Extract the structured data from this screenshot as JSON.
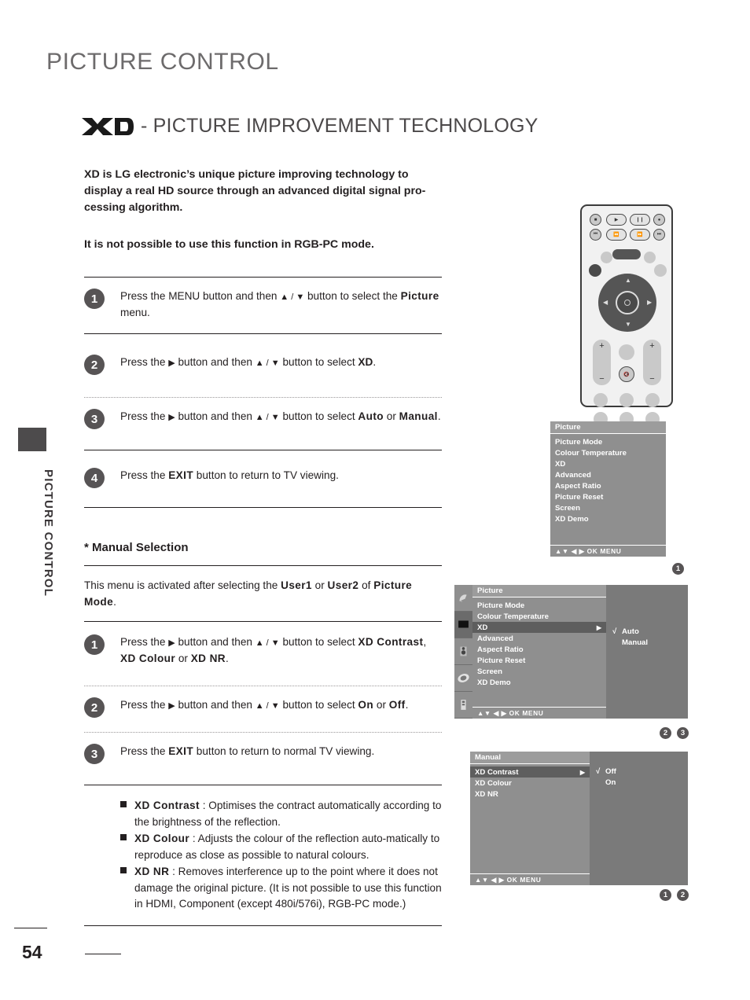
{
  "page": {
    "number": "54",
    "side_tab_label": "PICTURE CONTROL",
    "heading": "PICTURE CONTROL",
    "sub_heading": "- PICTURE IMPROVEMENT TECHNOLOGY",
    "logo_text": "XD"
  },
  "intro": {
    "paragraph1": "XD is LG electronic’s unique picture improving technology to display a real HD source through an advanced digital signal pro-cessing algorithm.",
    "paragraph2": "It is not possible to use this function in RGB-PC mode."
  },
  "steps": [
    {
      "number": "1",
      "parts": [
        {
          "t": "Press the MENU button and then ",
          "s": "n"
        },
        {
          "t": "▲ / ▼",
          "s": "arr"
        },
        {
          "t": " button to select the ",
          "s": "n"
        },
        {
          "t": "Picture",
          "s": "mono"
        },
        {
          "t": "  menu.",
          "s": "n"
        }
      ]
    },
    {
      "number": "2",
      "parts": [
        {
          "t": "Press the ",
          "s": "n"
        },
        {
          "t": "▶",
          "s": "arr"
        },
        {
          "t": " button and then ",
          "s": "n"
        },
        {
          "t": "▲ / ▼",
          "s": "arr"
        },
        {
          "t": " button to select ",
          "s": "n"
        },
        {
          "t": "XD",
          "s": "b"
        },
        {
          "t": ".",
          "s": "n"
        }
      ]
    },
    {
      "number": "3",
      "parts": [
        {
          "t": "Press the ",
          "s": "n"
        },
        {
          "t": "▶",
          "s": "arr"
        },
        {
          "t": " button and then ",
          "s": "n"
        },
        {
          "t": "▲ / ▼",
          "s": "arr"
        },
        {
          "t": " button to select ",
          "s": "n"
        },
        {
          "t": "Auto",
          "s": "mono"
        },
        {
          "t": " or ",
          "s": "n"
        },
        {
          "t": "Manual",
          "s": "mono"
        },
        {
          "t": ".",
          "s": "n"
        }
      ]
    },
    {
      "number": "4",
      "parts": [
        {
          "t": "Press the ",
          "s": "n"
        },
        {
          "t": "EXIT",
          "s": "mono"
        },
        {
          "t": " button to return to TV viewing.",
          "s": "n"
        }
      ]
    }
  ],
  "manual_section": {
    "title": "* Manual Selection",
    "note_parts": [
      {
        "t": "This menu is activated after selecting the ",
        "s": "n"
      },
      {
        "t": "User1",
        "s": "mono"
      },
      {
        "t": " or ",
        "s": "n"
      },
      {
        "t": "User2",
        "s": "mono"
      },
      {
        "t": " of ",
        "s": "n"
      },
      {
        "t": "Picture Mode",
        "s": "mono"
      },
      {
        "t": ".",
        "s": "n"
      }
    ],
    "steps": [
      {
        "number": "1",
        "parts": [
          {
            "t": "Press the ",
            "s": "n"
          },
          {
            "t": "▶",
            "s": "arr"
          },
          {
            "t": " button and then ",
            "s": "n"
          },
          {
            "t": "▲ / ▼",
            "s": "arr"
          },
          {
            "t": " button to select ",
            "s": "n"
          },
          {
            "t": "XD Contrast",
            "s": "mono"
          },
          {
            "t": ", ",
            "s": "n"
          },
          {
            "t": "XD Colour",
            "s": "mono"
          },
          {
            "t": " or ",
            "s": "n"
          },
          {
            "t": "XD NR",
            "s": "mono"
          },
          {
            "t": ".",
            "s": "n"
          }
        ]
      },
      {
        "number": "2",
        "parts": [
          {
            "t": "Press the ",
            "s": "n"
          },
          {
            "t": "▶",
            "s": "arr"
          },
          {
            "t": " button and then ",
            "s": "n"
          },
          {
            "t": "▲ / ▼",
            "s": "arr"
          },
          {
            "t": " button to select ",
            "s": "n"
          },
          {
            "t": "On",
            "s": "mono"
          },
          {
            "t": " or ",
            "s": "n"
          },
          {
            "t": "Off",
            "s": "mono"
          },
          {
            "t": ".",
            "s": "n"
          }
        ]
      },
      {
        "number": "3",
        "parts": [
          {
            "t": "Press the ",
            "s": "n"
          },
          {
            "t": "EXIT",
            "s": "mono"
          },
          {
            "t": " button to return to normal TV viewing.",
            "s": "n"
          }
        ]
      }
    ]
  },
  "definitions": [
    {
      "term": "XD Contrast",
      "body": " : Optimises the contract automatically according to the brightness of the reflection."
    },
    {
      "term": "XD Colour",
      "body": " : Adjusts the colour of the reflection auto-matically to reproduce as close as possible to natural colours."
    },
    {
      "term": "XD NR",
      "body": " : Removes interference up to the point where it does not damage the original picture. (It is not possible to use this function in HDMI, Component (except 480i/576i), RGB-PC mode.)"
    }
  ],
  "osd": {
    "nav_hint": "▲▼  ◀ ▶  OK  MENU",
    "icon_names": [
      "satellite-dish-icon",
      "picture-tv-icon",
      "speaker-audio-icon",
      "clock-time-icon",
      "remote-setup-icon"
    ],
    "menu1": {
      "title": "Picture",
      "items": [
        "Picture Mode",
        "Colour Temperature",
        "XD",
        "Advanced",
        "Aspect Ratio",
        "Picture Reset",
        "Screen",
        "XD Demo"
      ],
      "selected_index": -1,
      "markers": [
        "1"
      ]
    },
    "menu2": {
      "title": "Picture",
      "items": [
        "Picture Mode",
        "Colour Temperature",
        "XD",
        "Advanced",
        "Aspect Ratio",
        "Picture Reset",
        "Screen",
        "XD Demo"
      ],
      "selected_index": 2,
      "submenu_options": [
        "Auto",
        "Manual"
      ],
      "submenu_checked": "Auto",
      "markers": [
        "2",
        "3"
      ]
    },
    "menu3": {
      "title": "Manual",
      "items": [
        "XD Contrast",
        "XD Colour",
        "XD NR"
      ],
      "selected_index": 0,
      "submenu_options": [
        "Off",
        "On"
      ],
      "submenu_checked": "Off",
      "markers": [
        "1",
        "2"
      ]
    }
  },
  "remote": {
    "label": "tv-remote-control",
    "buttons": {
      "row1": [
        "stop",
        "play",
        "pause",
        "record"
      ],
      "row2": [
        "skip-back",
        "rewind",
        "fast-forward",
        "skip-forward"
      ],
      "volume": "+/-",
      "channel": "+/-",
      "mute": "mute"
    }
  },
  "colors": {
    "heading_grey": "#6d6b6c",
    "subheading_grey": "#4b4849",
    "badge_grey": "#575455",
    "osd_bg": "#8f8f8f",
    "osd_selected": "#5e5e5e",
    "osd_submenu": "#7a7a7a",
    "text": "#231f20"
  }
}
